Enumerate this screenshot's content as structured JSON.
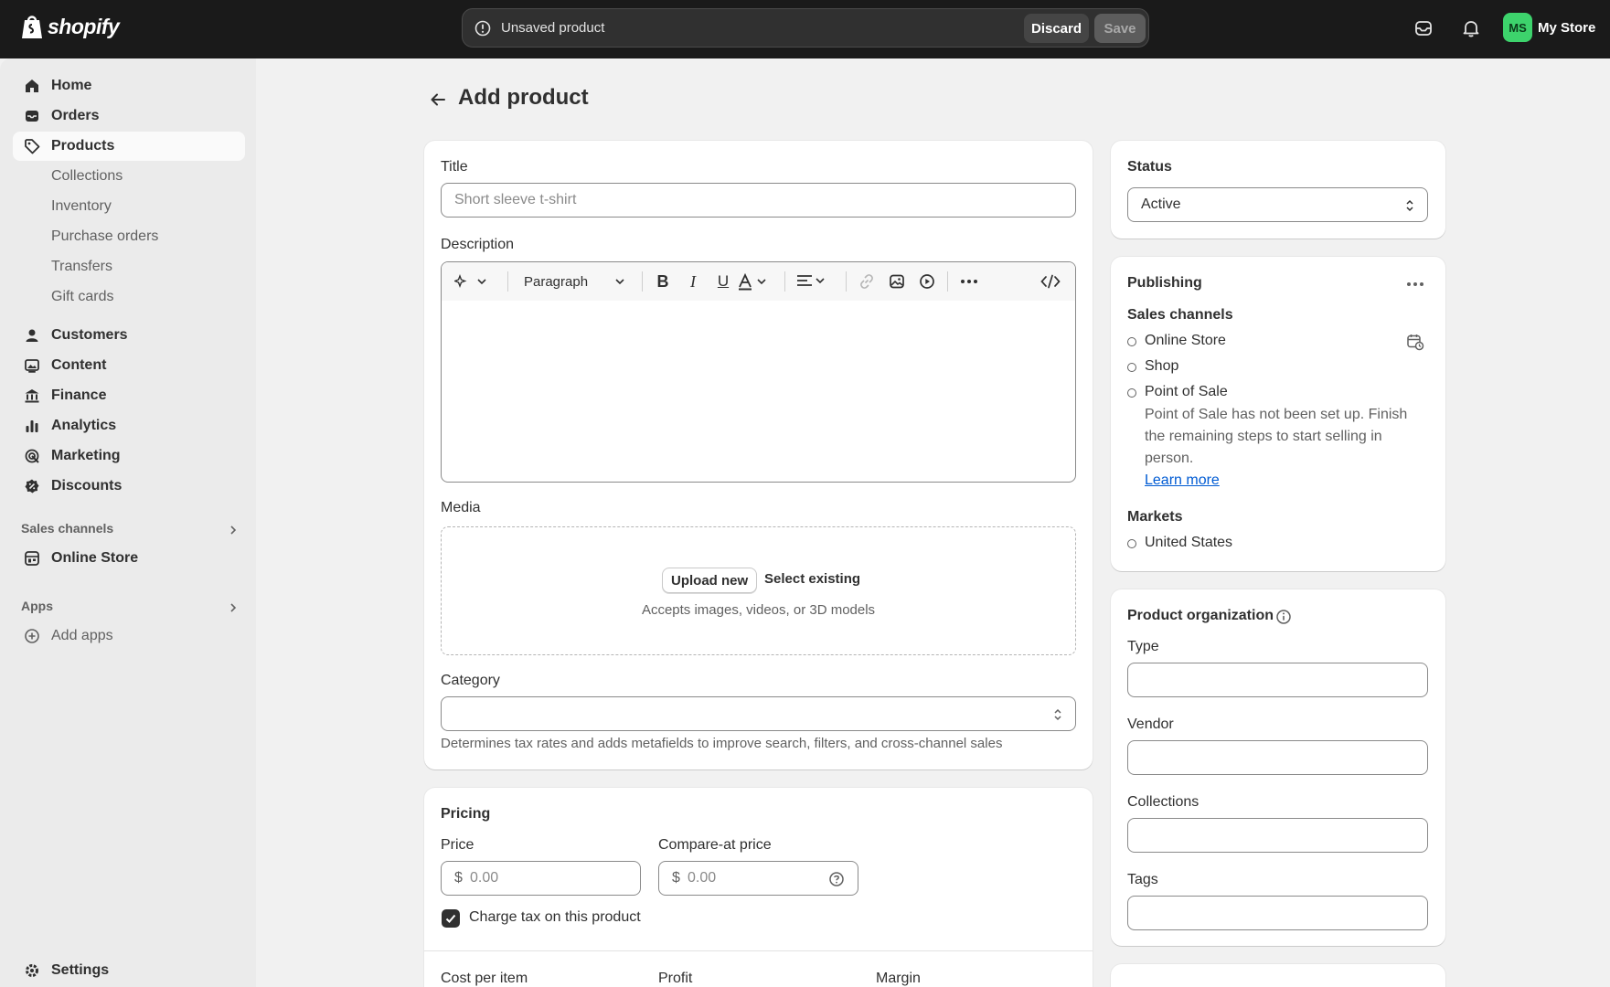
{
  "brand": {
    "name": "shopify"
  },
  "topbar": {
    "unsaved_label": "Unsaved product",
    "discard_label": "Discard",
    "save_label": "Save",
    "store_initials": "MS",
    "store_name": "My Store"
  },
  "sidebar": {
    "items": [
      {
        "label": "Home",
        "icon": "home-icon"
      },
      {
        "label": "Orders",
        "icon": "orders-icon"
      },
      {
        "label": "Products",
        "icon": "tag-icon"
      },
      {
        "label": "Collections"
      },
      {
        "label": "Inventory"
      },
      {
        "label": "Purchase orders"
      },
      {
        "label": "Transfers"
      },
      {
        "label": "Gift cards"
      },
      {
        "label": "Customers",
        "icon": "person-icon"
      },
      {
        "label": "Content",
        "icon": "content-icon"
      },
      {
        "label": "Finance",
        "icon": "bank-icon"
      },
      {
        "label": "Analytics",
        "icon": "bar-chart-icon"
      },
      {
        "label": "Marketing",
        "icon": "target-icon"
      },
      {
        "label": "Discounts",
        "icon": "discount-icon"
      }
    ],
    "sales_channels_heading": "Sales channels",
    "online_store_label": "Online Store",
    "apps_heading": "Apps",
    "add_apps_label": "Add apps",
    "settings_label": "Settings"
  },
  "page": {
    "title": "Add product"
  },
  "product_card": {
    "title_label": "Title",
    "title_placeholder": "Short sleeve t-shirt",
    "description_label": "Description",
    "paragraph_label": "Paragraph",
    "media_label": "Media",
    "upload_new": "Upload new",
    "select_existing": "Select existing",
    "media_note": "Accepts images, videos, or 3D models",
    "category_label": "Category",
    "category_help": "Determines tax rates and adds metafields to improve search, filters, and cross-channel sales"
  },
  "pricing": {
    "heading": "Pricing",
    "price_label": "Price",
    "price_currency": "$",
    "price_placeholder": "0.00",
    "compare_label": "Compare-at price",
    "compare_currency": "$",
    "compare_placeholder": "0.00",
    "charge_tax_label": "Charge tax on this product",
    "cost_label": "Cost per item",
    "profit_label": "Profit",
    "margin_label": "Margin"
  },
  "status": {
    "heading": "Status",
    "value": "Active"
  },
  "publishing": {
    "heading": "Publishing",
    "sales_channels_label": "Sales channels",
    "channels": [
      "Online Store",
      "Shop",
      "Point of Sale"
    ],
    "pos_note_1": "Point of Sale has not been set up. Finish",
    "pos_note_2": "the remaining steps to start selling in",
    "pos_note_3": "person.",
    "learn_more": "Learn more",
    "markets_label": "Markets",
    "markets": [
      "United States"
    ]
  },
  "organization": {
    "heading": "Product organization",
    "type_label": "Type",
    "vendor_label": "Vendor",
    "collections_label": "Collections",
    "tags_label": "Tags"
  },
  "theme": {
    "link_color": "#005bd3",
    "avatar_color": "#3dd36c"
  }
}
